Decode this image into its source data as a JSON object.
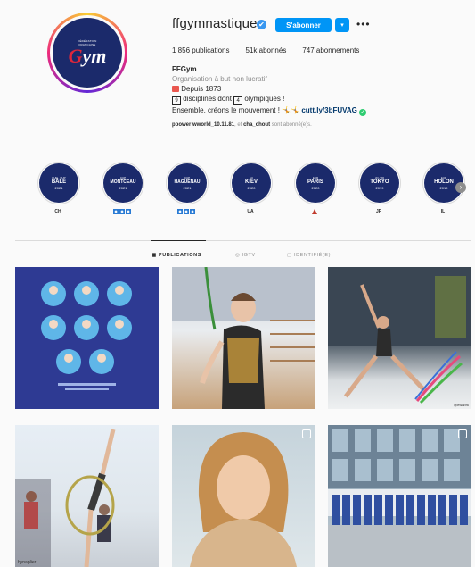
{
  "profile": {
    "username": "ffgymnastique",
    "follow_label": "S'abonner",
    "dropdown_icon": "▾",
    "more_icon": "•••",
    "verified_icon": "✔",
    "stats": {
      "publications": "1 856 publications",
      "followers": "51k abonnés",
      "following": "747 abonnements"
    },
    "avatar": {
      "line1": "FÉDÉRATION",
      "line2": "FRANÇAISE",
      "g": "G",
      "ym": "ym"
    },
    "bio": {
      "name": "FFGym",
      "category": "Organisation à but non lucratif",
      "since": "Depuis 1873",
      "disciplines_num": "9",
      "disciplines_text": "disciplines dont",
      "olympic_num": "4",
      "olympic_text": "olympiques !",
      "tagline": "Ensemble, créons le mouvement !",
      "link": "cutt.ly/3bFUVAG",
      "followed_by_pre": "ppower",
      "followed_by_1": "wworld_10.11.81",
      "followed_by_mid": "et",
      "followed_by_2": "cha_chout",
      "followed_by_post": "sont abonné(e)s."
    }
  },
  "highlights": [
    {
      "top": "EUR · CUP",
      "city": "BÂLE",
      "year": "2021",
      "label": "CH"
    },
    {
      "top": "CUP",
      "city": "MONTCEAU",
      "year": "2021",
      "label": ""
    },
    {
      "top": "CUP",
      "city": "HAGUENAU",
      "year": "2021",
      "label": ""
    },
    {
      "top": "EU",
      "city": "KIEV",
      "year": "2020",
      "label": "UA"
    },
    {
      "top": "EUR",
      "city": "PARIS",
      "year": "2020",
      "label": ""
    },
    {
      "top": "JO / JO",
      "city": "TOKYO",
      "year": "2019",
      "label": "JP"
    },
    {
      "top": "EUR",
      "city": "HOLON",
      "year": "2019",
      "label": "IL"
    }
  ],
  "highlight_next_icon": "›",
  "tabs": [
    {
      "label": "PUBLICATIONS",
      "icon": "grid-icon",
      "glyph": "▦"
    },
    {
      "label": "IGTV",
      "icon": "igtv-icon",
      "glyph": "◎"
    },
    {
      "label": "IDENTIFIÉ(E)",
      "icon": "tagged-icon",
      "glyph": "▢"
    }
  ],
  "posts": [
    {
      "caption": ""
    },
    {
      "caption": ""
    },
    {
      "caption": "@ewabrk"
    },
    {
      "caption": "bynaplier"
    },
    {
      "caption": ""
    },
    {
      "caption": ""
    }
  ]
}
